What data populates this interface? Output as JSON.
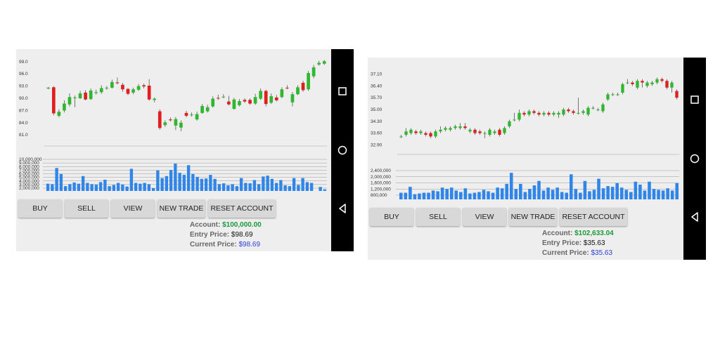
{
  "screens": [
    {
      "price_ticks": [
        "99.0",
        "96.0",
        "93.0",
        "90.0",
        "87.0",
        "84.0",
        "81.0"
      ],
      "volume_ticks": [
        "10,000,000",
        "9,000,000",
        "8,000,000",
        "7,000,000",
        "6,000,000",
        "5,000,000",
        "4,000,000",
        "3,000,000",
        "2,000,000"
      ],
      "buttons": [
        "BUY",
        "SELL",
        "VIEW",
        "NEW TRADE",
        "RESET ACCOUNT"
      ],
      "account_label": "Account:",
      "account_value": "$100,000.00",
      "entry_label": "Entry Price:",
      "entry_value": "$98.69",
      "current_label": "Current Price:",
      "current_value": "$98.69",
      "chart_data": {
        "type": "candlestick",
        "price_ylim": [
          80.0,
          100.0
        ],
        "volume_ylim": [
          1800000,
          10000000
        ],
        "candles": [
          {
            "o": 92.4,
            "c": 92.6,
            "h": 92.8,
            "l": 92.2
          },
          {
            "o": 92.7,
            "c": 86.3,
            "h": 93.0,
            "l": 85.8
          },
          {
            "o": 85.7,
            "c": 86.7,
            "h": 87.3,
            "l": 85.3
          },
          {
            "o": 87.0,
            "c": 88.7,
            "h": 89.5,
            "l": 86.5
          },
          {
            "o": 88.5,
            "c": 90.3,
            "h": 91.2,
            "l": 88.0
          },
          {
            "o": 90.1,
            "c": 90.2,
            "h": 90.7,
            "l": 87.8
          },
          {
            "o": 90.0,
            "c": 91.2,
            "h": 91.8,
            "l": 89.8
          },
          {
            "o": 91.4,
            "c": 89.7,
            "h": 92.0,
            "l": 89.5
          },
          {
            "o": 89.8,
            "c": 91.9,
            "h": 92.4,
            "l": 89.6
          },
          {
            "o": 91.3,
            "c": 91.5,
            "h": 92.1,
            "l": 90.9
          },
          {
            "o": 91.5,
            "c": 92.5,
            "h": 93.2,
            "l": 91.1
          },
          {
            "o": 92.5,
            "c": 92.6,
            "h": 93.0,
            "l": 92.1
          },
          {
            "o": 92.6,
            "c": 94.0,
            "h": 94.6,
            "l": 92.4
          },
          {
            "o": 93.9,
            "c": 93.7,
            "h": 95.1,
            "l": 93.4
          },
          {
            "o": 93.3,
            "c": 92.2,
            "h": 93.8,
            "l": 91.6
          },
          {
            "o": 92.3,
            "c": 91.1,
            "h": 92.5,
            "l": 90.8
          },
          {
            "o": 91.4,
            "c": 92.2,
            "h": 92.6,
            "l": 91.0
          },
          {
            "o": 92.1,
            "c": 93.0,
            "h": 93.5,
            "l": 91.8
          },
          {
            "o": 93.2,
            "c": 92.9,
            "h": 93.6,
            "l": 92.4
          },
          {
            "o": 93.1,
            "c": 89.7,
            "h": 94.7,
            "l": 89.4
          },
          {
            "o": 89.6,
            "c": 89.9,
            "h": 90.2,
            "l": 89.0
          },
          {
            "o": 86.8,
            "c": 82.7,
            "h": 87.3,
            "l": 82.3
          },
          {
            "o": 83.4,
            "c": 84.1,
            "h": 84.6,
            "l": 83.0
          },
          {
            "o": 84.8,
            "c": 84.6,
            "h": 85.3,
            "l": 84.3
          },
          {
            "o": 83.3,
            "c": 84.9,
            "h": 85.4,
            "l": 82.2
          },
          {
            "o": 82.8,
            "c": 84.0,
            "h": 84.6,
            "l": 81.9
          },
          {
            "o": 86.4,
            "c": 85.7,
            "h": 86.9,
            "l": 85.3
          },
          {
            "o": 85.9,
            "c": 86.0,
            "h": 86.5,
            "l": 85.5
          },
          {
            "o": 84.8,
            "c": 86.1,
            "h": 86.7,
            "l": 84.5
          },
          {
            "o": 86.4,
            "c": 88.1,
            "h": 88.6,
            "l": 86.2
          },
          {
            "o": 86.8,
            "c": 87.8,
            "h": 88.4,
            "l": 86.5
          },
          {
            "o": 88.0,
            "c": 89.9,
            "h": 90.5,
            "l": 87.7
          },
          {
            "o": 90.1,
            "c": 90.0,
            "h": 90.9,
            "l": 89.6
          },
          {
            "o": 90.3,
            "c": 90.4,
            "h": 91.0,
            "l": 90.0
          },
          {
            "o": 89.2,
            "c": 88.5,
            "h": 90.6,
            "l": 88.2
          },
          {
            "o": 87.4,
            "c": 89.7,
            "h": 90.1,
            "l": 87.2
          },
          {
            "o": 88.3,
            "c": 89.3,
            "h": 89.8,
            "l": 88.0
          },
          {
            "o": 89.6,
            "c": 89.2,
            "h": 90.0,
            "l": 88.9
          },
          {
            "o": 89.6,
            "c": 88.7,
            "h": 90.0,
            "l": 88.4
          },
          {
            "o": 88.7,
            "c": 90.3,
            "h": 91.1,
            "l": 88.4
          },
          {
            "o": 89.9,
            "c": 91.8,
            "h": 92.4,
            "l": 89.6
          },
          {
            "o": 91.8,
            "c": 88.6,
            "h": 92.1,
            "l": 88.0
          },
          {
            "o": 88.9,
            "c": 90.5,
            "h": 91.2,
            "l": 88.6
          },
          {
            "o": 90.2,
            "c": 89.5,
            "h": 90.8,
            "l": 89.2
          },
          {
            "o": 90.3,
            "c": 92.2,
            "h": 92.7,
            "l": 90.0
          },
          {
            "o": 92.6,
            "c": 92.5,
            "h": 93.2,
            "l": 92.2
          },
          {
            "o": 89.0,
            "c": 91.0,
            "h": 91.5,
            "l": 88.0
          },
          {
            "o": 91.0,
            "c": 92.7,
            "h": 93.2,
            "l": 90.8
          },
          {
            "o": 93.8,
            "c": 92.0,
            "h": 94.3,
            "l": 91.6
          },
          {
            "o": 92.2,
            "c": 96.2,
            "h": 96.7,
            "l": 91.8
          },
          {
            "o": 95.4,
            "c": 97.6,
            "h": 98.2,
            "l": 94.9
          },
          {
            "o": 98.3,
            "c": 98.7,
            "h": 99.2,
            "l": 98.0
          },
          {
            "o": 98.5,
            "c": 99.1,
            "h": 99.4,
            "l": 98.2
          }
        ],
        "volumes": [
          3600000,
          3500000,
          7500000,
          6000000,
          3000000,
          3500000,
          3900000,
          3600000,
          5500000,
          3800000,
          3500000,
          3400000,
          4000000,
          4600000,
          3000000,
          3300000,
          3800000,
          3400000,
          2900000,
          7300000,
          3800000,
          3600000,
          3800000,
          3500000,
          2500000,
          6900000,
          5000000,
          5500000,
          7000000,
          8600000,
          6300000,
          5800000,
          8200000,
          6000000,
          5300000,
          4800000,
          4900000,
          5800000,
          4800000,
          3500000,
          3700000,
          3200000,
          3500000,
          3000000,
          5000000,
          3800000,
          3700000,
          4500000,
          3500000,
          5400000,
          5600000,
          4800000,
          3800000,
          4500000,
          3200000,
          3000000,
          5000000,
          3300000,
          5000000,
          4000000,
          3800000,
          1800000,
          2800000,
          2200000
        ]
      }
    },
    {
      "price_ticks": [
        "37.10",
        "36.40",
        "35.70",
        "35.00",
        "34.30",
        "33.60",
        "32.90"
      ],
      "volume_ticks": [
        "2,400,000",
        "2,000,000",
        "1,600,000",
        "1,200,000",
        "800,000"
      ],
      "buttons": [
        "BUY",
        "SELL",
        "VIEW",
        "NEW TRADE",
        "RESET ACCOUNT"
      ],
      "account_label": "Account:",
      "account_value": "$102,633.04",
      "entry_label": "Entry Price:",
      "entry_value": "$35.63",
      "current_label": "Current Price:",
      "current_value": "$35.63",
      "chart_data": {
        "type": "candlestick",
        "price_ylim": [
          32.5,
          37.5
        ],
        "volume_ylim": [
          600000,
          2600000
        ],
        "candles": [
          {
            "o": 33.4,
            "c": 33.4,
            "h": 33.5,
            "l": 33.3
          },
          {
            "o": 33.5,
            "c": 33.7,
            "h": 33.9,
            "l": 33.4
          },
          {
            "o": 33.6,
            "c": 33.8,
            "h": 33.9,
            "l": 33.5
          },
          {
            "o": 33.7,
            "c": 33.6,
            "h": 33.8,
            "l": 33.5
          },
          {
            "o": 33.6,
            "c": 33.7,
            "h": 33.8,
            "l": 33.5
          },
          {
            "o": 33.6,
            "c": 33.5,
            "h": 33.7,
            "l": 33.4
          },
          {
            "o": 33.6,
            "c": 33.4,
            "h": 33.7,
            "l": 33.3
          },
          {
            "o": 33.4,
            "c": 33.7,
            "h": 33.8,
            "l": 33.3
          },
          {
            "o": 33.7,
            "c": 33.8,
            "h": 34.0,
            "l": 33.6
          },
          {
            "o": 33.8,
            "c": 33.9,
            "h": 34.0,
            "l": 33.7
          },
          {
            "o": 33.8,
            "c": 33.9,
            "h": 34.0,
            "l": 33.7
          },
          {
            "o": 33.9,
            "c": 34.0,
            "h": 34.1,
            "l": 33.8
          },
          {
            "o": 33.9,
            "c": 34.0,
            "h": 34.2,
            "l": 33.8
          },
          {
            "o": 34.0,
            "c": 33.9,
            "h": 34.2,
            "l": 33.8
          },
          {
            "o": 33.7,
            "c": 33.8,
            "h": 33.9,
            "l": 33.6
          },
          {
            "o": 33.8,
            "c": 33.6,
            "h": 33.9,
            "l": 33.5
          },
          {
            "o": 33.7,
            "c": 33.6,
            "h": 33.8,
            "l": 33.5
          },
          {
            "o": 33.6,
            "c": 33.6,
            "h": 33.7,
            "l": 33.3
          },
          {
            "o": 33.5,
            "c": 33.8,
            "h": 33.9,
            "l": 33.4
          },
          {
            "o": 33.6,
            "c": 33.7,
            "h": 33.8,
            "l": 33.5
          },
          {
            "o": 33.8,
            "c": 33.5,
            "h": 33.9,
            "l": 33.4
          },
          {
            "o": 33.6,
            "c": 33.9,
            "h": 34.0,
            "l": 33.5
          },
          {
            "o": 34.0,
            "c": 34.3,
            "h": 34.4,
            "l": 33.9
          },
          {
            "o": 34.4,
            "c": 34.4,
            "h": 34.8,
            "l": 34.3
          },
          {
            "o": 34.4,
            "c": 34.8,
            "h": 35.0,
            "l": 34.3
          },
          {
            "o": 34.8,
            "c": 34.7,
            "h": 34.9,
            "l": 34.6
          },
          {
            "o": 34.7,
            "c": 34.9,
            "h": 35.0,
            "l": 34.6
          },
          {
            "o": 34.9,
            "c": 34.8,
            "h": 35.0,
            "l": 34.7
          },
          {
            "o": 34.8,
            "c": 34.7,
            "h": 34.9,
            "l": 34.6
          },
          {
            "o": 34.7,
            "c": 34.8,
            "h": 34.9,
            "l": 34.6
          },
          {
            "o": 34.8,
            "c": 34.7,
            "h": 34.9,
            "l": 34.6
          },
          {
            "o": 34.7,
            "c": 34.8,
            "h": 34.9,
            "l": 34.6
          },
          {
            "o": 34.7,
            "c": 34.8,
            "h": 34.9,
            "l": 34.5
          },
          {
            "o": 34.7,
            "c": 35.0,
            "h": 35.1,
            "l": 34.6
          },
          {
            "o": 35.0,
            "c": 34.9,
            "h": 35.1,
            "l": 34.8
          },
          {
            "o": 34.9,
            "c": 34.8,
            "h": 35.0,
            "l": 34.7
          },
          {
            "o": 34.8,
            "c": 34.8,
            "h": 35.7,
            "l": 34.7
          },
          {
            "o": 34.8,
            "c": 34.9,
            "h": 35.0,
            "l": 34.7
          },
          {
            "o": 34.7,
            "c": 35.1,
            "h": 35.2,
            "l": 34.6
          },
          {
            "o": 35.1,
            "c": 35.1,
            "h": 35.2,
            "l": 35.0
          },
          {
            "o": 35.0,
            "c": 35.0,
            "h": 35.1,
            "l": 34.9
          },
          {
            "o": 34.9,
            "c": 35.3,
            "h": 35.4,
            "l": 34.8
          },
          {
            "o": 35.6,
            "c": 35.9,
            "h": 36.0,
            "l": 35.5
          },
          {
            "o": 35.9,
            "c": 35.9,
            "h": 36.0,
            "l": 35.8
          },
          {
            "o": 35.9,
            "c": 35.9,
            "h": 36.0,
            "l": 35.8
          },
          {
            "o": 36.0,
            "c": 36.5,
            "h": 36.6,
            "l": 35.9
          },
          {
            "o": 36.6,
            "c": 36.6,
            "h": 36.8,
            "l": 36.5
          },
          {
            "o": 36.6,
            "c": 36.5,
            "h": 36.7,
            "l": 36.4
          },
          {
            "o": 36.3,
            "c": 36.7,
            "h": 36.8,
            "l": 36.2
          },
          {
            "o": 36.7,
            "c": 36.6,
            "h": 36.8,
            "l": 36.3
          },
          {
            "o": 36.4,
            "c": 36.6,
            "h": 36.7,
            "l": 36.3
          },
          {
            "o": 36.5,
            "c": 36.6,
            "h": 36.7,
            "l": 36.4
          },
          {
            "o": 36.6,
            "c": 36.8,
            "h": 36.9,
            "l": 36.5
          },
          {
            "o": 36.8,
            "c": 36.7,
            "h": 36.9,
            "l": 36.6
          },
          {
            "o": 36.7,
            "c": 36.3,
            "h": 36.8,
            "l": 36.2
          },
          {
            "o": 36.3,
            "c": 36.6,
            "h": 36.7,
            "l": 36.0
          },
          {
            "o": 36.1,
            "c": 35.7,
            "h": 36.2,
            "l": 35.6
          }
        ],
        "volumes": [
          1050000,
          1050000,
          1450000,
          950000,
          1000000,
          1050000,
          1050000,
          1200000,
          1150000,
          1400000,
          1300000,
          1400000,
          1200000,
          1100000,
          1350000,
          1000000,
          1050000,
          1100000,
          1250000,
          1150000,
          1050000,
          1400000,
          1350000,
          1650000,
          2400000,
          1300000,
          1650000,
          1100000,
          1300000,
          1550000,
          1850000,
          1200000,
          1400000,
          1250000,
          1400000,
          1100000,
          1050000,
          2300000,
          1300000,
          1050000,
          1850000,
          1150000,
          1250000,
          2000000,
          1350000,
          1500000,
          1450000,
          1700000,
          1400000,
          1250000,
          1100000,
          1800000,
          1600000,
          1200000,
          1800000,
          1300000,
          1250000,
          1200000,
          1350000,
          1200000,
          1700000
        ]
      }
    }
  ]
}
